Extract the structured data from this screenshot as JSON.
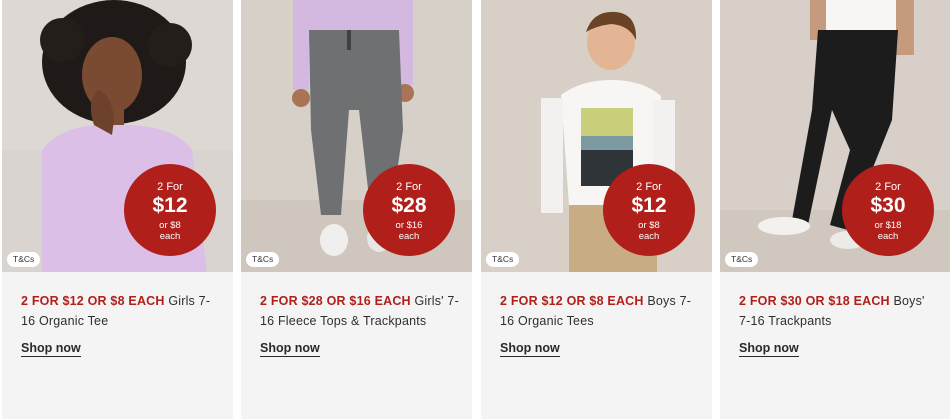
{
  "products": [
    {
      "promo": "2 FOR $12 OR $8 EACH",
      "name": " Girls 7-16 Organic Tee",
      "badge": {
        "line1": "2 For",
        "price": "$12",
        "or": "or $8",
        "each": "each"
      },
      "tcs": "T&Cs",
      "shop": "Shop now",
      "photo_subject": "girl-lilac-organic-tee"
    },
    {
      "promo": "2 FOR $28 OR $16 EACH",
      "name": " Girls' 7-16 Fleece Tops & Trackpants",
      "badge": {
        "line1": "2 For",
        "price": "$28",
        "or": "or $16",
        "each": "each"
      },
      "tcs": "T&Cs",
      "shop": "Shop now",
      "photo_subject": "grey-fleece-trackpants"
    },
    {
      "promo": "2 FOR $12 OR $8 EACH",
      "name": " Boys 7-16 Organic Tees",
      "badge": {
        "line1": "2 For",
        "price": "$12",
        "or": "or $8",
        "each": "each"
      },
      "tcs": "T&Cs",
      "shop": "Shop now",
      "photo_subject": "boy-white-graphic-tee"
    },
    {
      "promo": "2 FOR $30 OR $18 EACH",
      "name": " Boys' 7-16 Trackpants",
      "badge": {
        "line1": "2 For",
        "price": "$30",
        "or": "or $18",
        "each": "each"
      },
      "tcs": "T&Cs",
      "shop": "Shop now",
      "photo_subject": "black-trackpants"
    }
  ],
  "colors": {
    "promo_red": "#b01f1a",
    "card_bg": "#f4f4f4"
  }
}
